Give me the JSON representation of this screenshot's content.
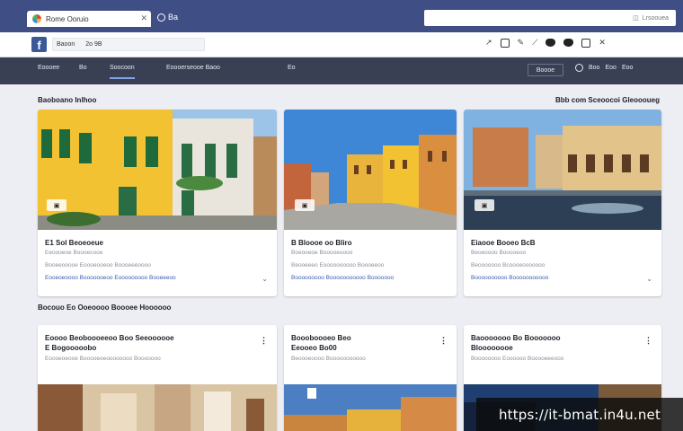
{
  "browser": {
    "tab_title": "Rome Ooruio",
    "new_tab_label": "Ba",
    "search_placeholder": "Lrsoouea",
    "address_text": "Baoon",
    "address_path": "2o 9B",
    "toolbar_icons": [
      "share-icon",
      "frame-icon",
      "pencil-icon",
      "brush-icon",
      "blob-icon",
      "blob-icon",
      "bookmark-icon",
      "close-icon"
    ]
  },
  "facebook": {
    "logo_text": "f"
  },
  "navbar": {
    "items": [
      "Eoooee",
      "Bo",
      "Soocoon",
      "Eoooerseooe Baoo",
      "Eo"
    ],
    "right_pill": "Boooe",
    "right_items": [
      "Boo",
      "Eoo",
      "Eoo"
    ]
  },
  "section1": {
    "title": "Baoboano Inlhoo",
    "right": "Bbb com Sceoocoi Gleoooueg"
  },
  "section2": {
    "title": "Bocouo Eo Ooeoooo Boooee Hoooooo"
  },
  "cards_row1": [
    {
      "title": "E1 Sol Beoeoeue",
      "sub": "Eeoooeoe Boooecooe",
      "meta": "Booeeooooe Eoooeooeoo Boooeeeoooo",
      "link": "Eooeoeoooo Booooooeoo Eooooooooo Booeeeoo"
    },
    {
      "title": "B Bloooe oo Bliro",
      "sub": "Boeooeoe Booooeoooo",
      "meta": "Beooeeeo Eoooooooooo Boooeeoo",
      "link": "Booooooooo Booooooooooo Booooooo"
    },
    {
      "title": "Eiaooe Booeo BcB",
      "sub": "Beoeoooo Booooeoo",
      "meta": "Beooooooo Bcoooeooooooo",
      "link": "Boooooooooo Booooooooooo"
    }
  ],
  "cards_row2": [
    {
      "title": "Eoooo Beoboooeeoo Boo Seeoooooe",
      "title2": "E Bogooooobo",
      "sub": "Eoooeoeooe Booooeoeoooooooo Booooooo"
    },
    {
      "title": "Boooboooeo Beo",
      "title2": "Eeooeo Bo00",
      "sub": "Beoooeoooo Booooooooooo"
    },
    {
      "title": "Baooooooo Bo Booooooo",
      "title2": "Bloooooooe",
      "sub": "Boooooooo Eoooooo Booooeeeooo"
    }
  ],
  "watermark": {
    "text": "https://it-bmat.in4u.net"
  }
}
